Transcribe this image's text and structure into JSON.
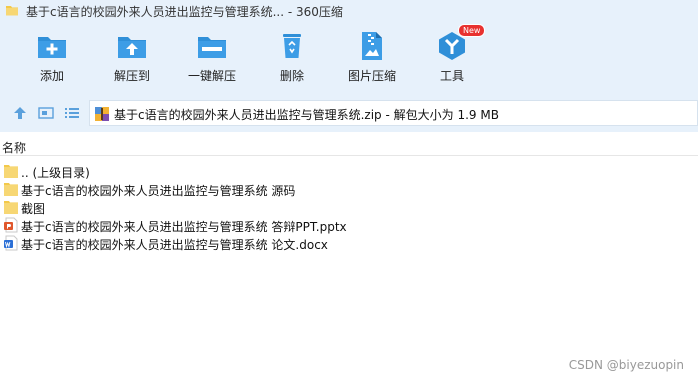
{
  "window": {
    "title": "基于c语言的校园外来人员进出监控与管理系统... - 360压缩"
  },
  "toolbar": {
    "add": "添加",
    "extract_to": "解压到",
    "one_click_extract": "一键解压",
    "delete": "删除",
    "image_compress": "图片压缩",
    "tools": "工具",
    "tools_badge": "New"
  },
  "address": {
    "path": "基于c语言的校园外来人员进出监控与管理系统.zip - 解包大小为 1.9 MB"
  },
  "list": {
    "column_name": "名称",
    "items": [
      {
        "name": ".. (上级目录)",
        "type": "folder"
      },
      {
        "name": "基于c语言的校园外来人员进出监控与管理系统 源码",
        "type": "folder"
      },
      {
        "name": "截图",
        "type": "folder"
      },
      {
        "name": "基于c语言的校园外来人员进出监控与管理系统 答辩PPT.pptx",
        "type": "pptx"
      },
      {
        "name": "基于c语言的校园外来人员进出监控与管理系统 论文.docx",
        "type": "docx"
      }
    ]
  },
  "watermark": "CSDN @biyezuopin",
  "colors": {
    "chrome_bg": "#e7f1fb",
    "icon_blue": "#2f8fd8",
    "folder_yellow": "#f7d774",
    "pptx_orange": "#e0572c",
    "docx_blue": "#2b6fd6",
    "badge_red": "#e8312f"
  }
}
